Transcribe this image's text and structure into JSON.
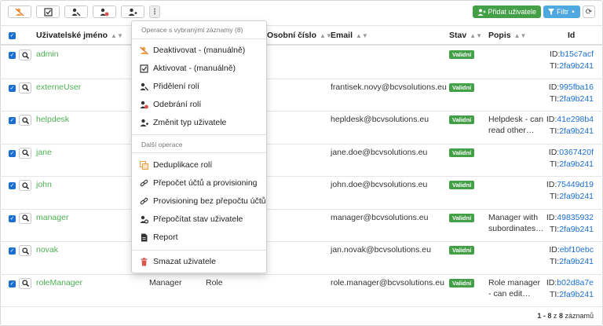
{
  "toolbar": {
    "buttons": [
      "deactivate-icon",
      "check-square-icon",
      "user-key-icon",
      "user-remove-key-icon",
      "user-type-icon"
    ],
    "more_label": "⋮",
    "add_user_label": "Přidat uživatele",
    "filter_label": "Filtr"
  },
  "table": {
    "headers": {
      "username": "Uživatelské jméno",
      "personal_number": "Osobní číslo",
      "email": "Email",
      "state": "Stav",
      "description": "Popis",
      "id": "Id"
    },
    "rows": [
      {
        "username": "admin",
        "first": "",
        "last": "",
        "email": "",
        "state": "Validní",
        "description": "",
        "id": "b15c7acf",
        "ti": "2fa9b241"
      },
      {
        "username": "externeUser",
        "first": "",
        "last": "",
        "email": "frantisek.novy@bcvsolutions.eu",
        "state": "Validní",
        "description": "",
        "id": "995fba16",
        "ti": "2fa9b241"
      },
      {
        "username": "helpdesk",
        "first": "",
        "last": "",
        "email": "hepldesk@bcvsolutions.eu",
        "state": "Validní",
        "description": "Helpdesk - can read other…",
        "id": "41e298b4",
        "ti": "2fa9b241"
      },
      {
        "username": "jane",
        "first": "",
        "last": "",
        "email": "jane.doe@bcvsolutions.eu",
        "state": "Validní",
        "description": "",
        "id": "0367420f",
        "ti": "2fa9b241"
      },
      {
        "username": "john",
        "first": "",
        "last": "",
        "email": "john.doe@bcvsolutions.eu",
        "state": "Validní",
        "description": "",
        "id": "75449d19",
        "ti": "2fa9b241"
      },
      {
        "username": "manager",
        "first": "",
        "last": "",
        "email": "manager@bcvsolutions.eu",
        "state": "Validní",
        "description": "Manager with subordinates…",
        "id": "49835932",
        "ti": "2fa9b241"
      },
      {
        "username": "novak",
        "first": "",
        "last": "",
        "email": "jan.novak@bcvsolutions.eu",
        "state": "Validní",
        "description": "",
        "id": "ebf10ebc",
        "ti": "2fa9b241"
      },
      {
        "username": "roleManager",
        "first": "Manager",
        "last": "Role",
        "email": "role.manager@bcvsolutions.eu",
        "state": "Validní",
        "description": "Role manager - can edit…",
        "id": "b02d8a7e",
        "ti": "2fa9b241"
      }
    ],
    "id_prefix": "ID:",
    "ti_prefix": "TI:"
  },
  "menu": {
    "header1": "Operace s vybranými záznamy (8)",
    "items1": [
      "Deaktivovat - (manuálně)",
      "Aktivovat - (manuálně)",
      "Přidělení rolí",
      "Odebrání rolí",
      "Změnit typ uživatele"
    ],
    "header2": "Další operace",
    "items2": [
      "Deduplikace rolí",
      "Přepočet účtů a provisioning",
      "Provisioning bez přepočtu účtů",
      "Přepočítat stav uživatele",
      "Report"
    ],
    "delete": "Smazat uživatele"
  },
  "footer": {
    "range": "1 - 8",
    "of": "z",
    "total": "8",
    "suffix": "záznamů"
  },
  "colors": {
    "green": "#43a047",
    "blue": "#1a6fd1",
    "filter_blue": "#4fa9e0",
    "delete_red": "#d9534f"
  }
}
